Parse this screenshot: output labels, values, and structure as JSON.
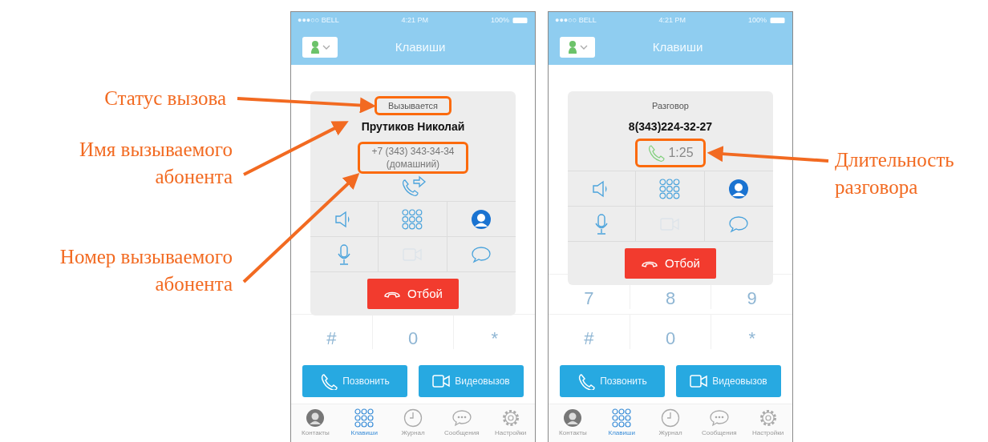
{
  "left_annotations": [
    "Статус вызова",
    "Имя вызываемого абонента",
    "Номер вызываемого абонента"
  ],
  "right_annotations": [
    "Длительность разговора"
  ],
  "phones": [
    {
      "status_bar": {
        "carrier": "●●●○○ BELL",
        "time": "4:21 PM",
        "battery": "100%"
      },
      "header": {
        "title": "Клавиши"
      },
      "keypad_rows": [
        [
          "#",
          "0",
          "*"
        ]
      ],
      "call": {
        "blocks": [
          {
            "kind": "status",
            "texts": [
              "Вызывается"
            ],
            "highlighted": true
          },
          {
            "kind": "name",
            "texts": [
              "Прутиков Николай"
            ],
            "highlighted": false
          },
          {
            "kind": "number",
            "texts": [
              "+7 (343) 343-34-34",
              "(домашний)"
            ],
            "highlighted": true
          },
          {
            "kind": "transfer"
          }
        ],
        "actions": [
          {
            "kind": "speaker",
            "disabled": false
          },
          {
            "kind": "keypad",
            "disabled": false
          },
          {
            "kind": "contact",
            "disabled": false
          },
          {
            "kind": "mic",
            "disabled": false
          },
          {
            "kind": "video",
            "disabled": true
          },
          {
            "kind": "chat",
            "disabled": false
          }
        ],
        "hangup": "Отбой"
      },
      "buttons": [
        {
          "kind": "call",
          "label": "Позвонить"
        },
        {
          "kind": "video",
          "label": "Видеовызов"
        }
      ],
      "tabs": [
        {
          "kind": "contacts",
          "label": "Контакты",
          "selected": false
        },
        {
          "kind": "keypad",
          "label": "Клавиши",
          "selected": true
        },
        {
          "kind": "journal",
          "label": "Журнал",
          "selected": false
        },
        {
          "kind": "messages",
          "label": "Сообщения",
          "selected": false
        },
        {
          "kind": "settings",
          "label": "Настройки",
          "selected": false
        }
      ]
    },
    {
      "status_bar": {
        "carrier": "●●●○○ BELL",
        "time": "4:21 PM",
        "battery": "100%"
      },
      "header": {
        "title": "Клавиши"
      },
      "keypad_rows": [
        [
          "7",
          "8",
          "9"
        ],
        [
          "#",
          "0",
          "*"
        ]
      ],
      "call": {
        "blocks": [
          {
            "kind": "status",
            "texts": [
              "Разговор"
            ],
            "highlighted": false
          },
          {
            "kind": "name",
            "texts": [
              "8(343)224-32-27"
            ],
            "highlighted": false
          },
          {
            "kind": "duration",
            "texts": [
              "1:25"
            ],
            "highlighted": true
          }
        ],
        "actions": [
          {
            "kind": "speaker",
            "disabled": false
          },
          {
            "kind": "keypad",
            "disabled": false
          },
          {
            "kind": "contact",
            "disabled": false
          },
          {
            "kind": "mic",
            "disabled": false
          },
          {
            "kind": "video",
            "disabled": true
          },
          {
            "kind": "chat",
            "disabled": false
          }
        ],
        "hangup": "Отбой"
      },
      "buttons": [
        {
          "kind": "call",
          "label": "Позвонить"
        },
        {
          "kind": "video",
          "label": "Видеовызов"
        }
      ],
      "tabs": [
        {
          "kind": "contacts",
          "label": "Контакты",
          "selected": false
        },
        {
          "kind": "keypad",
          "label": "Клавиши",
          "selected": true
        },
        {
          "kind": "journal",
          "label": "Журнал",
          "selected": false
        },
        {
          "kind": "messages",
          "label": "Сообщения",
          "selected": false
        },
        {
          "kind": "settings",
          "label": "Настройки",
          "selected": false
        }
      ]
    }
  ]
}
